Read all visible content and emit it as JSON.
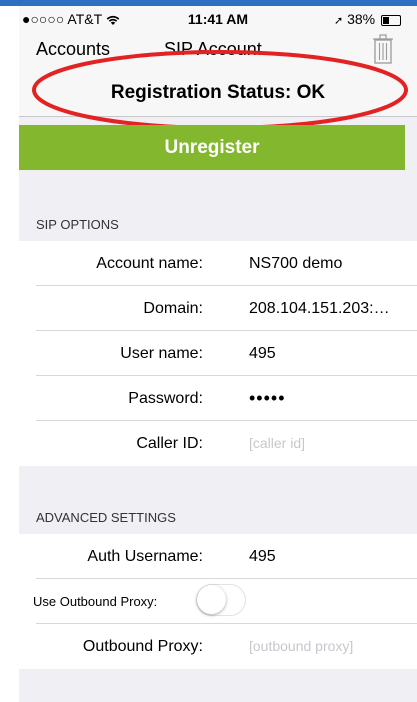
{
  "status_bar": {
    "carrier": "●○○○○ AT&T",
    "time": "11:41 AM",
    "battery": "38%",
    "battery_level": 0.38
  },
  "nav_bar": {
    "back_label": "Accounts",
    "title": "SIP Account",
    "trash_icon": "trash-icon"
  },
  "registration": {
    "status_text": "Registration Status: OK",
    "highlight_color": "#e32222"
  },
  "unregister": {
    "label": "Unregister",
    "color": "#82b72e"
  },
  "sip_options": {
    "header": "SIP OPTIONS",
    "account_name_label": "Account name:",
    "account_name_value": "NS700 demo",
    "domain_label": "Domain:",
    "domain_value": "208.104.151.203:…",
    "user_name_label": "User name:",
    "user_name_value": "495",
    "password_label": "Password:",
    "password_value": "•••••",
    "caller_id_label": "Caller ID:",
    "caller_id_placeholder": "[caller id]"
  },
  "advanced": {
    "header": "ADVANCED SETTINGS",
    "auth_username_label": "Auth Username:",
    "auth_username_value": "495",
    "use_outbound_proxy_label": "Use Outbound Proxy:",
    "use_outbound_proxy_on": false,
    "outbound_proxy_label": "Outbound Proxy:",
    "outbound_proxy_placeholder": "[outbound proxy]"
  }
}
